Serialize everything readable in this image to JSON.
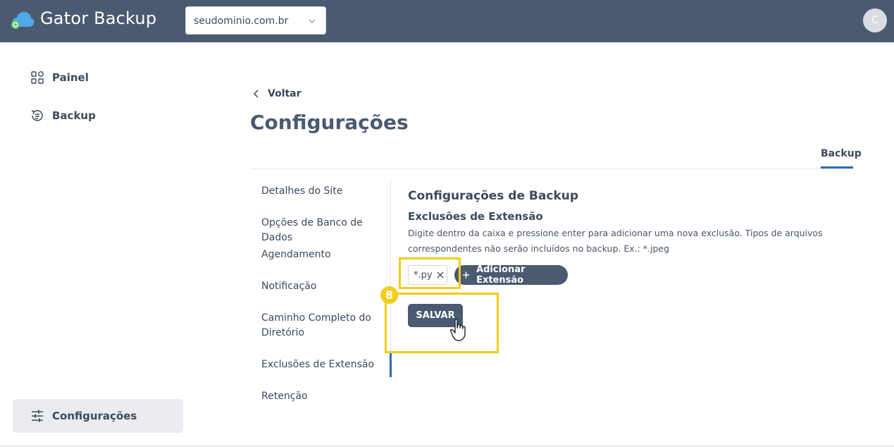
{
  "app": {
    "title": "Gator Backup",
    "avatar_initial": "C"
  },
  "domain_select": {
    "value": "seudominio.com.br"
  },
  "sidebar": {
    "items": [
      {
        "label": "Painel",
        "icon": "dashboard-icon"
      },
      {
        "label": "Backup",
        "icon": "backup-history-icon"
      }
    ],
    "bottom": {
      "label": "Configurações",
      "icon": "sliders-icon"
    }
  },
  "main": {
    "back_label": "Voltar",
    "page_title": "Configurações",
    "tab_label": "Backup",
    "nav": [
      {
        "label": "Detalhes do Site"
      },
      {
        "label": "Opções de Banco de Dados"
      },
      {
        "label": "Agendamento"
      },
      {
        "label": "Notificação"
      },
      {
        "label": "Caminho Completo do Diretório"
      },
      {
        "label": "Exclusões de Extensão",
        "active": true
      },
      {
        "label": "Retenção"
      }
    ],
    "section_title": "Configurações de Backup",
    "subsection_title": "Exclusões de Extensão",
    "description": "Digite dentro da caixa e pressione enter para adicionar uma nova exclusão. Tipos de arquivos correspondentes não serão incluídos no backup. Ex.: *.jpeg",
    "tag_value": "*.py",
    "add_button_label": "Adicionar Extensão",
    "save_button_label": "SALVAR"
  },
  "annotation": {
    "step_number": "8",
    "highlight_color": "#f2cd1a"
  },
  "colors": {
    "topbar": "#4a5a70",
    "accent": "#2f6db5",
    "button": "#4a5a70"
  }
}
